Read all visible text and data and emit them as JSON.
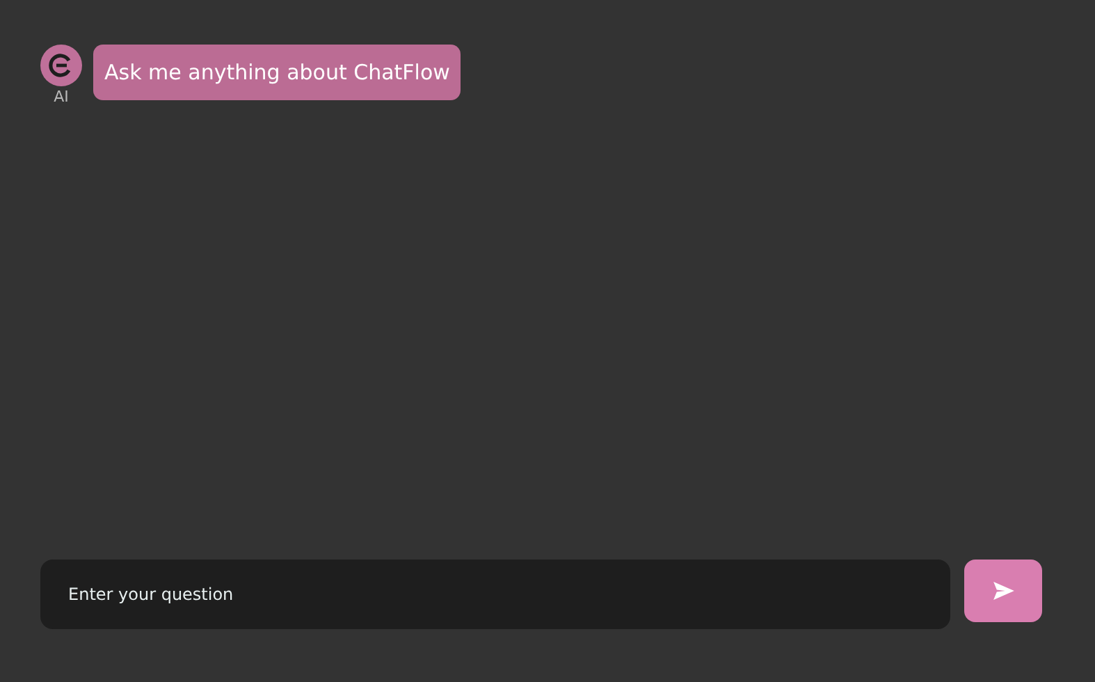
{
  "messages": [
    {
      "kind": "ai",
      "sender": "AI",
      "text": "Ask me anything about ChatFlow"
    }
  ],
  "input": {
    "placeholder": "Enter your question"
  }
}
